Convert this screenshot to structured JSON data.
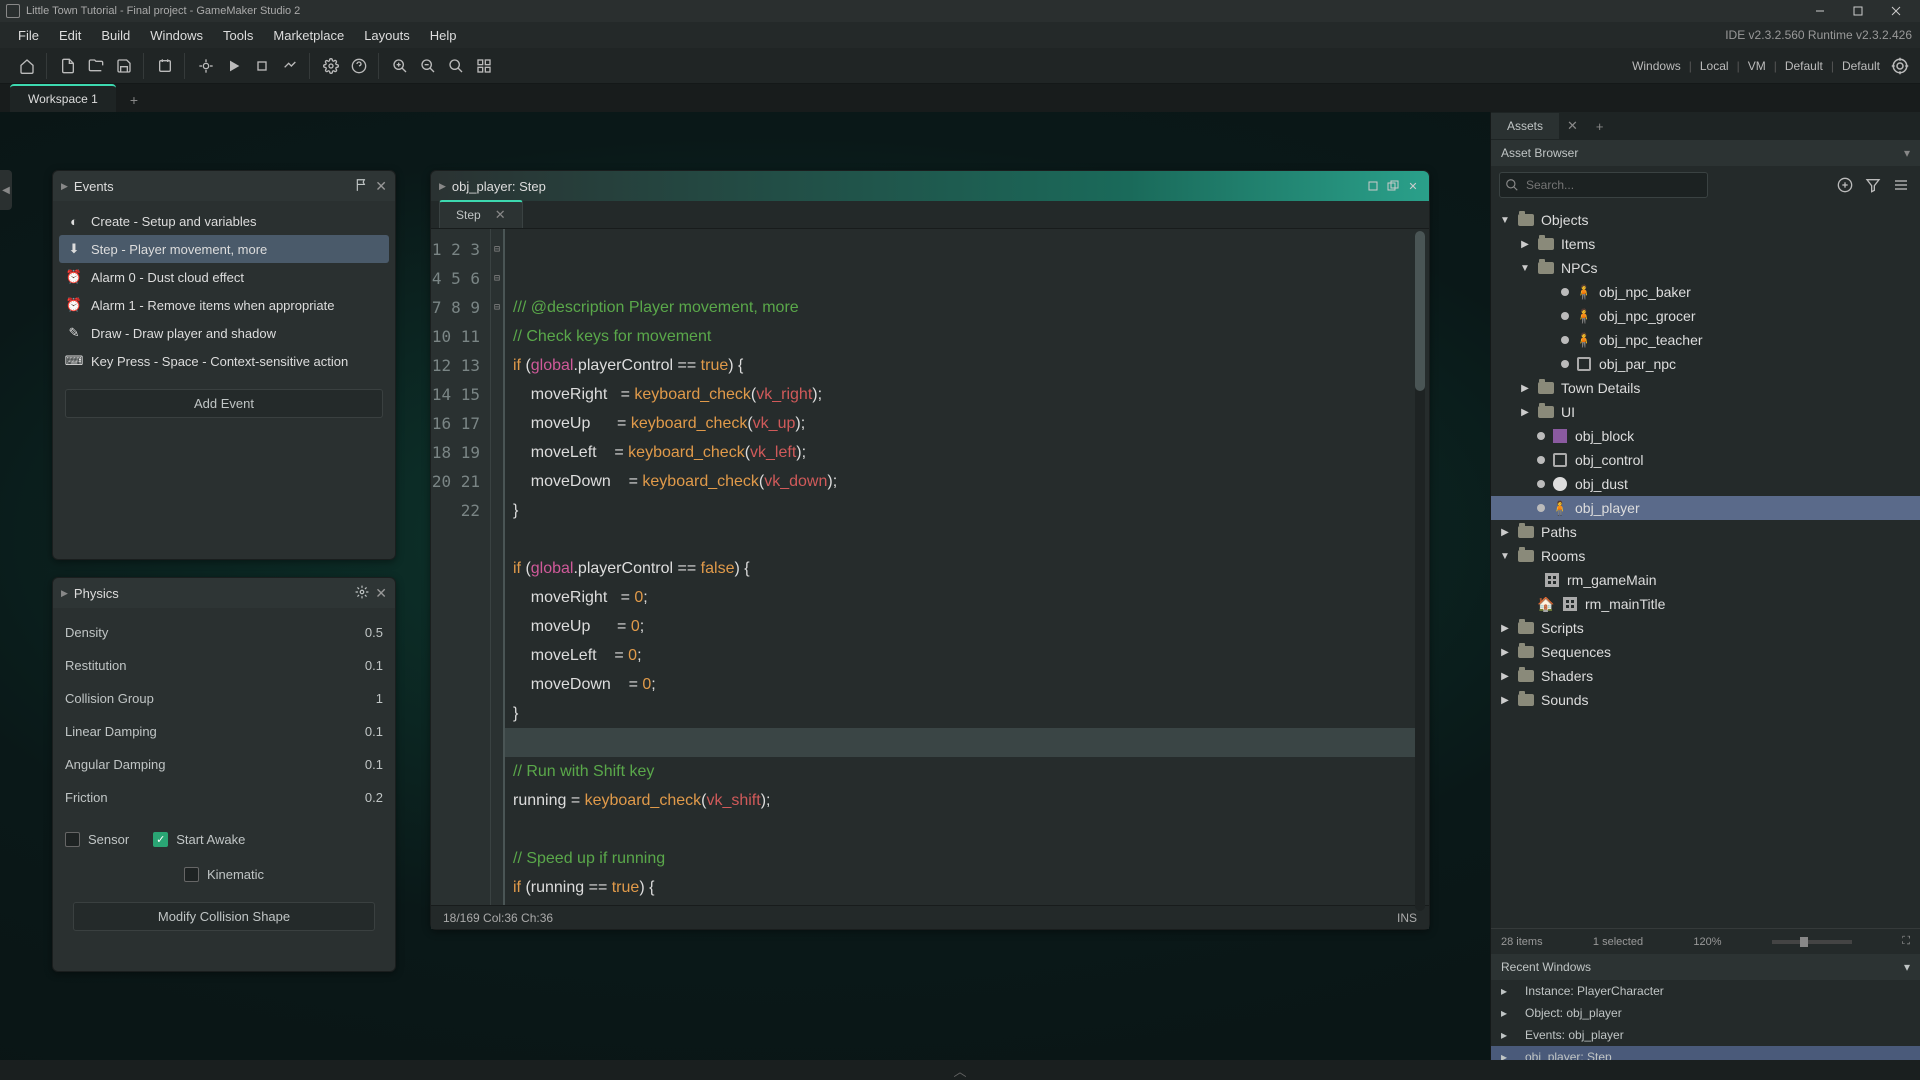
{
  "titlebar": {
    "text": "Little Town Tutorial - Final project - GameMaker Studio 2"
  },
  "menubar": {
    "items": [
      "File",
      "Edit",
      "Build",
      "Windows",
      "Tools",
      "Marketplace",
      "Layouts",
      "Help"
    ],
    "version": "IDE v2.3.2.560   Runtime v2.3.2.426"
  },
  "toolbar_right": {
    "windows": "Windows",
    "local": "Local",
    "vm": "VM",
    "default1": "Default",
    "default2": "Default"
  },
  "workspace": {
    "tab": "Workspace 1"
  },
  "events": {
    "title": "Events",
    "items": [
      {
        "label": "Create - Setup and variables",
        "icon": "create"
      },
      {
        "label": "Step - Player movement, more",
        "icon": "step",
        "selected": true
      },
      {
        "label": "Alarm 0 - Dust cloud effect",
        "icon": "alarm"
      },
      {
        "label": "Alarm 1 - Remove items when appropriate",
        "icon": "alarm"
      },
      {
        "label": "Draw - Draw player and shadow",
        "icon": "draw"
      },
      {
        "label": "Key Press - Space - Context-sensitive action",
        "icon": "key"
      }
    ],
    "add": "Add Event"
  },
  "physics": {
    "title": "Physics",
    "rows": [
      {
        "k": "Density",
        "v": "0.5"
      },
      {
        "k": "Restitution",
        "v": "0.1"
      },
      {
        "k": "Collision Group",
        "v": "1"
      },
      {
        "k": "Linear Damping",
        "v": "0.1"
      },
      {
        "k": "Angular Damping",
        "v": "0.1"
      },
      {
        "k": "Friction",
        "v": "0.2"
      }
    ],
    "sensor": "Sensor",
    "startawake": "Start Awake",
    "kinematic": "Kinematic",
    "modify": "Modify Collision Shape"
  },
  "code": {
    "title": "obj_player: Step",
    "tab": "Step",
    "status_left": "18/169 Col:36 Ch:36",
    "status_right": "INS",
    "highlight_line": 18,
    "lines": 22
  },
  "assets": {
    "tab": "Assets",
    "browser": "Asset Browser",
    "search_ph": "Search...",
    "footer_items": "28 items",
    "footer_sel": "1 selected",
    "footer_zoom": "120%"
  },
  "tree": [
    {
      "d": 0,
      "arrow": "open",
      "type": "folder",
      "label": "Objects"
    },
    {
      "d": 1,
      "arrow": "closed",
      "type": "folder",
      "label": "Items"
    },
    {
      "d": 1,
      "arrow": "open",
      "type": "folder",
      "label": "NPCs"
    },
    {
      "d": 2,
      "arrow": "none",
      "dot": true,
      "type": "sprite",
      "label": "obj_npc_baker"
    },
    {
      "d": 2,
      "arrow": "none",
      "dot": true,
      "type": "sprite",
      "label": "obj_npc_grocer"
    },
    {
      "d": 2,
      "arrow": "none",
      "dot": true,
      "type": "sprite",
      "label": "obj_npc_teacher"
    },
    {
      "d": 2,
      "arrow": "none",
      "dot": true,
      "type": "obj",
      "label": "obj_par_npc"
    },
    {
      "d": 1,
      "arrow": "closed",
      "type": "folder",
      "label": "Town Details"
    },
    {
      "d": 1,
      "arrow": "closed",
      "type": "folder",
      "label": "UI"
    },
    {
      "d": 1,
      "arrow": "none",
      "dot": true,
      "type": "block",
      "label": "obj_block"
    },
    {
      "d": 1,
      "arrow": "none",
      "dot": true,
      "type": "obj",
      "label": "obj_control"
    },
    {
      "d": 1,
      "arrow": "none",
      "dot": true,
      "type": "dust",
      "label": "obj_dust"
    },
    {
      "d": 1,
      "arrow": "none",
      "dot": true,
      "type": "player",
      "label": "obj_player",
      "selected": true
    },
    {
      "d": 0,
      "arrow": "closed",
      "type": "folder",
      "label": "Paths"
    },
    {
      "d": 0,
      "arrow": "open",
      "type": "folder",
      "label": "Rooms"
    },
    {
      "d": 1,
      "arrow": "none",
      "type": "room",
      "label": "rm_gameMain"
    },
    {
      "d": 1,
      "arrow": "none",
      "type": "room",
      "label": "rm_mainTitle",
      "home": true
    },
    {
      "d": 0,
      "arrow": "closed",
      "type": "folder",
      "label": "Scripts"
    },
    {
      "d": 0,
      "arrow": "closed",
      "type": "folder",
      "label": "Sequences"
    },
    {
      "d": 0,
      "arrow": "closed",
      "type": "folder",
      "label": "Shaders"
    },
    {
      "d": 0,
      "arrow": "closed",
      "type": "folder",
      "label": "Sounds"
    }
  ],
  "recent": {
    "title": "Recent Windows",
    "items": [
      {
        "label": "Instance: PlayerCharacter"
      },
      {
        "label": "Object: obj_player"
      },
      {
        "label": "Events: obj_player"
      },
      {
        "label": "obj_player: Step",
        "sel": true
      }
    ]
  }
}
